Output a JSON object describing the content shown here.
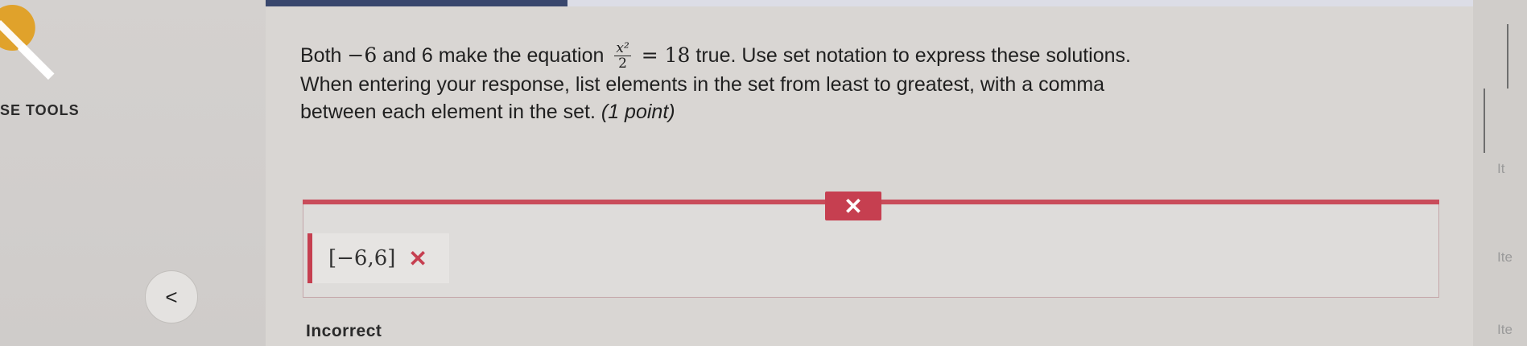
{
  "progress": {
    "fraction": 0.25
  },
  "sidebar": {
    "tools_label": "SE TOOLS",
    "tools_icon": "wrench-icon",
    "back_icon": "chevron-left-icon",
    "back_glyph": "<"
  },
  "question": {
    "line1_a": "Both",
    "line1_neg6": "−6",
    "line1_b": "and 6 make the equation",
    "fraction_num": "x²",
    "fraction_den": "2",
    "line1_eq": "= 18",
    "line1_c": "true. Use set notation to express these solutions.",
    "line2": "When entering your response, list elements in the set from least to greatest, with a comma",
    "line3_a": "between each element in the set.",
    "line3_points": "(1 point)"
  },
  "feedback": {
    "tab_glyph": "✕",
    "answer": "[−6,6]",
    "answer_mark": "✕",
    "result": "Incorrect"
  },
  "right_fragments": [
    "It",
    "Ite",
    "Ite"
  ],
  "colors": {
    "accent_red": "#c63f50",
    "progress": "#39476d",
    "background": "#d9d6d3"
  }
}
